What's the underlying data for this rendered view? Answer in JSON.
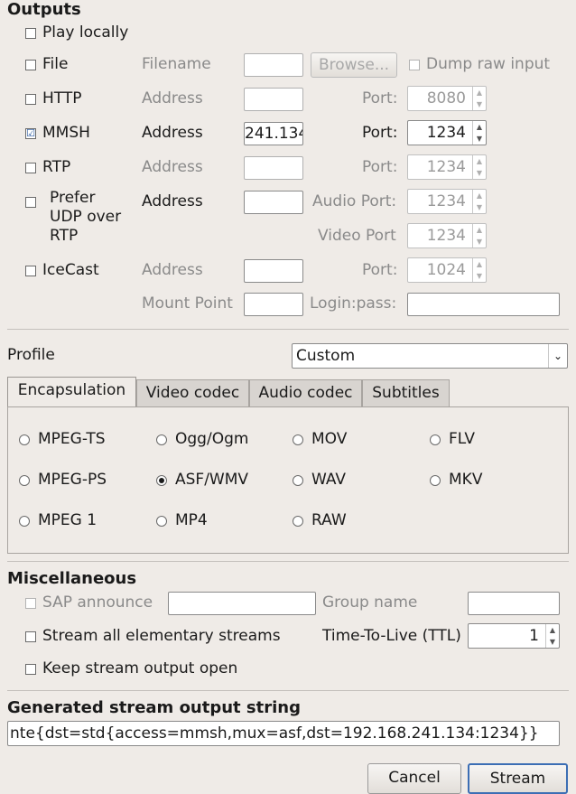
{
  "outputs": {
    "title": "Outputs",
    "play_locally": "Play locally",
    "file": {
      "label": "File",
      "filename_label": "Filename",
      "browse": "Browse...",
      "dump_raw": "Dump raw input"
    },
    "http": {
      "label": "HTTP",
      "address_label": "Address",
      "port_label": "Port:",
      "port": "8080"
    },
    "mmsh": {
      "label": "MMSH",
      "checked": "☑",
      "address_label": "Address",
      "address_value": "241.134",
      "port_label": "Port:",
      "port": "1234"
    },
    "rtp": {
      "label": "RTP",
      "address_label": "Address",
      "port_label": "Port:",
      "port": "1234"
    },
    "udp": {
      "label_line1": "Prefer",
      "label_line2": "UDP over",
      "label_line3": "RTP",
      "address_label": "Address",
      "audio_port_label": "Audio Port:",
      "audio_port": "1234",
      "video_port_label": "Video Port",
      "video_port": "1234"
    },
    "icecast": {
      "label": "IceCast",
      "address_label": "Address",
      "port_label": "Port:",
      "port": "1024",
      "mount_point_label": "Mount Point",
      "login_label": "Login:pass:"
    }
  },
  "profile": {
    "label": "Profile",
    "selected": "Custom"
  },
  "tabs": [
    "Encapsulation",
    "Video codec",
    "Audio codec",
    "Subtitles"
  ],
  "encapsulation": {
    "options": [
      "MPEG-TS",
      "Ogg/Ogm",
      "MOV",
      "FLV",
      "MPEG-PS",
      "ASF/WMV",
      "WAV",
      "MKV",
      "MPEG 1",
      "MP4",
      "RAW"
    ],
    "selected": "ASF/WMV"
  },
  "misc": {
    "title": "Miscellaneous",
    "sap_announce": "SAP announce",
    "group_name": "Group name",
    "stream_all": "Stream all elementary streams",
    "ttl_label": "Time-To-Live (TTL)",
    "ttl_value": "1",
    "keep_open": "Keep stream output open"
  },
  "generated": {
    "title": "Generated stream output string",
    "value": "nte{dst=std{access=mmsh,mux=asf,dst=192.168.241.134:1234}}"
  },
  "buttons": {
    "cancel": "Cancel",
    "stream": "Stream"
  },
  "colors": {
    "background": "#efebe7",
    "accent": "#2a5aa0"
  }
}
